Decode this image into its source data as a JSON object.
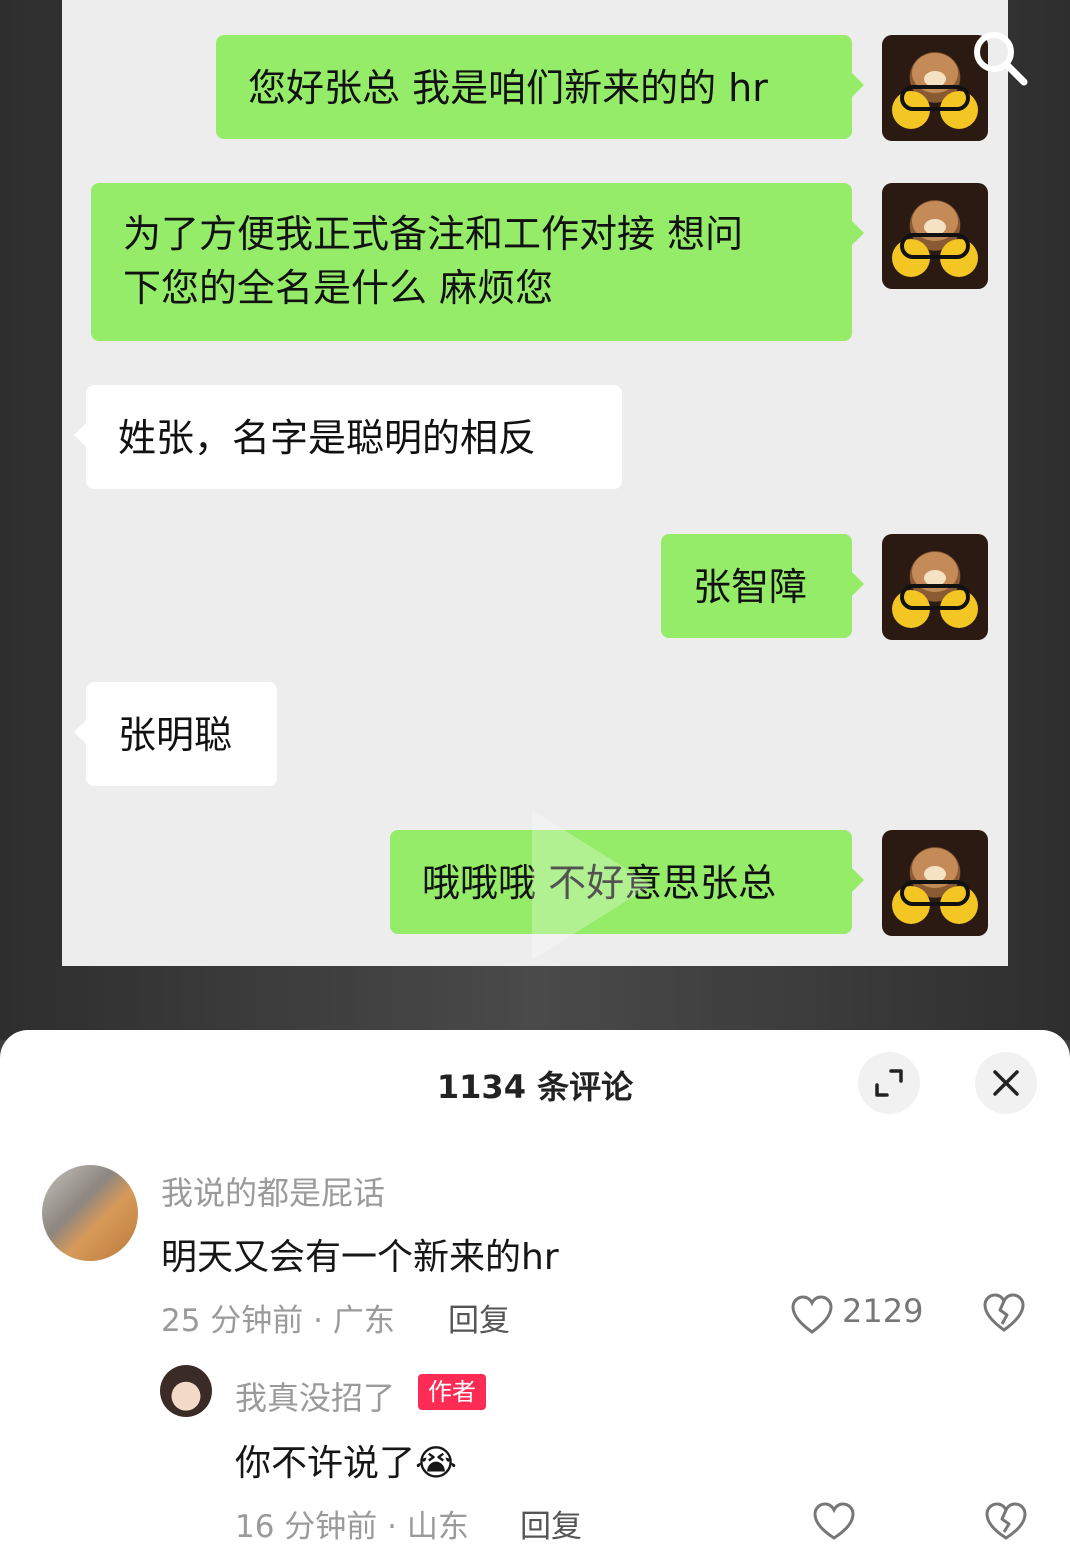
{
  "chat": {
    "messages": [
      {
        "side": "me",
        "text": "您好张总 我是咱们新来的的 hr"
      },
      {
        "side": "me",
        "text_line1": "为了方便我正式备注和工作对接 想问",
        "text_line2": "下您的全名是什么 麻烦您"
      },
      {
        "side": "them",
        "text": "姓张，名字是聪明的相反"
      },
      {
        "side": "me",
        "text": "张智障"
      },
      {
        "side": "them",
        "text": "张明聪"
      },
      {
        "side": "me",
        "text": "哦哦哦 不好意思张总"
      }
    ]
  },
  "comments_panel": {
    "title": "1134 条评论",
    "comments": [
      {
        "username": "我说的都是屁话",
        "text": "明天又会有一个新来的hr",
        "time_location": "25 分钟前 · 广东",
        "reply_label": "回复",
        "likes": "2129"
      },
      {
        "username": "我真没招了",
        "badge": "作者",
        "text": "你不许说了😭",
        "time_location": "16 分钟前 · 山东",
        "reply_label": "回复"
      }
    ]
  },
  "icons": [
    "search-icon",
    "expand-icon",
    "close-icon",
    "heart-icon",
    "broken-heart-icon",
    "play-icon"
  ],
  "colors": {
    "my_bubble": "#95ec69",
    "their_bubble": "#ffffff",
    "author_badge": "#fe2c55"
  }
}
